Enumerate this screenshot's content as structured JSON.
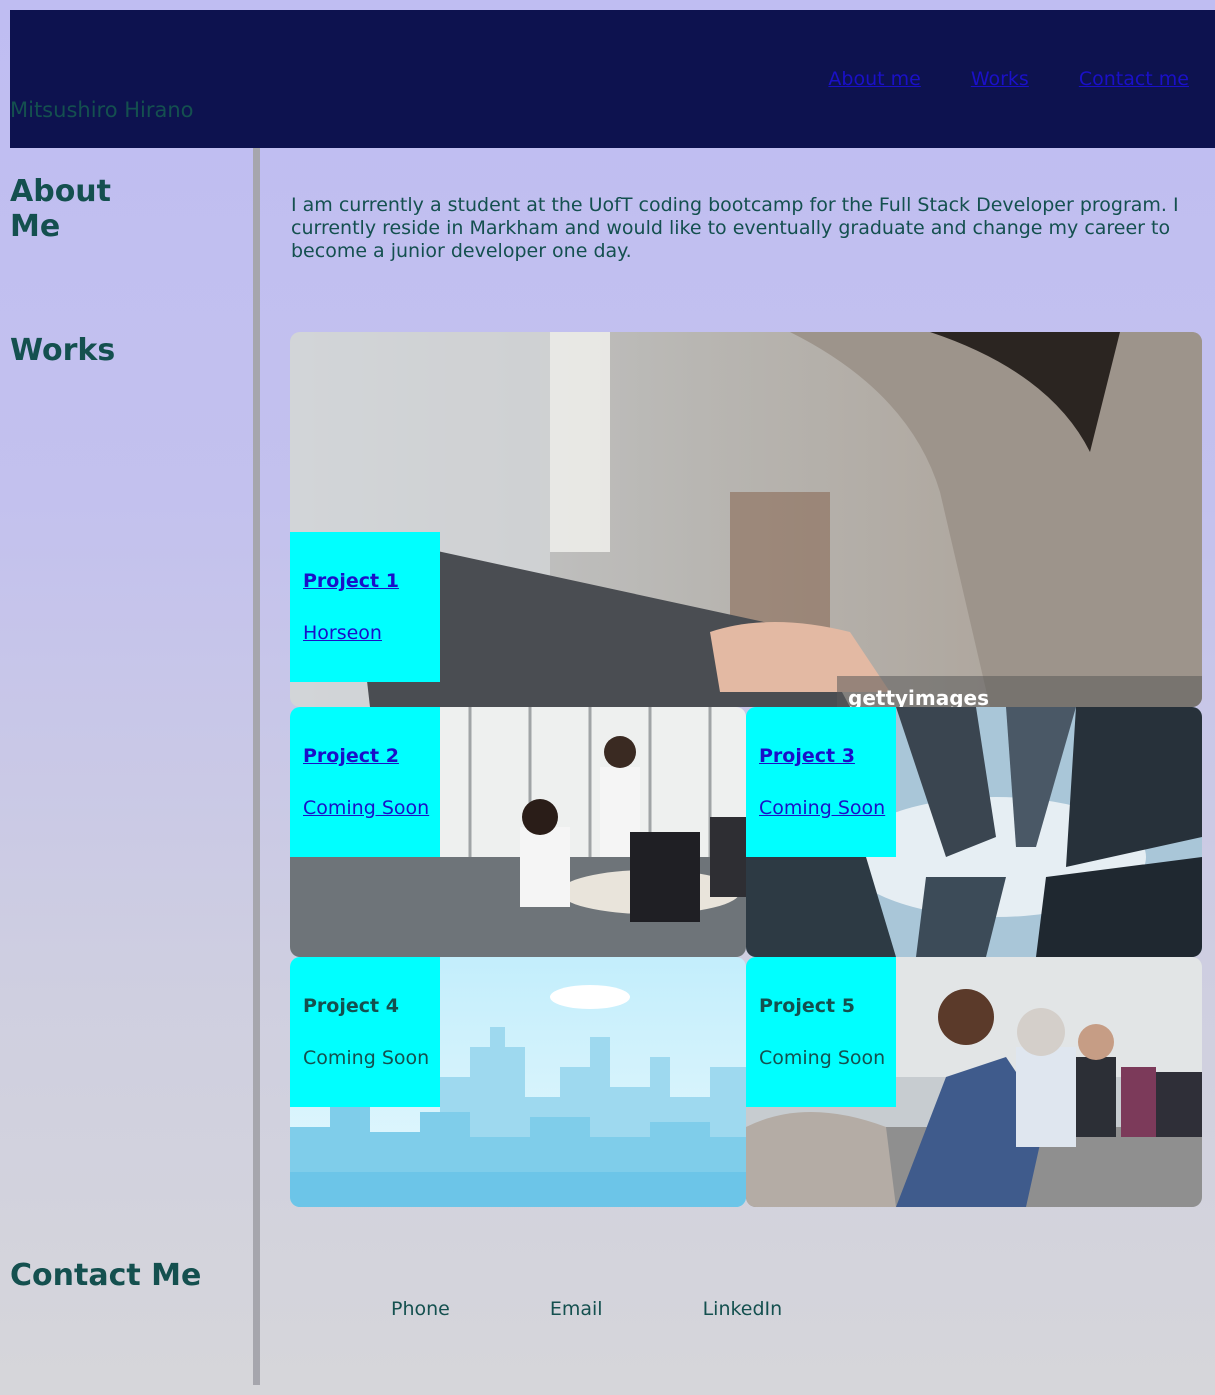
{
  "header": {
    "site_name": "Mitsushiro Hirano",
    "nav": [
      "About me",
      "Works",
      "Contact me"
    ]
  },
  "about": {
    "heading": "About\nMe",
    "text": "I am currently a student at the UofT coding bootcamp for the Full Stack Developer program. I currently reside in Markham and would like to eventually graduate and change my career to become a junior developer one day."
  },
  "works": {
    "heading": "Works",
    "projects": [
      {
        "title": "Project 1",
        "subtitle": "Horseon",
        "watermark": "gettyimages"
      },
      {
        "title": "Project 2",
        "subtitle": "Coming Soon"
      },
      {
        "title": "Project 3",
        "subtitle": "Coming Soon"
      },
      {
        "title": "Project 4",
        "subtitle": "Coming Soon"
      },
      {
        "title": "Project 5",
        "subtitle": "Coming Soon"
      }
    ]
  },
  "contact": {
    "heading": "Contact Me",
    "links": [
      "Phone",
      "Email",
      "LinkedIn"
    ]
  },
  "colors": {
    "header_bg": "#0d124f",
    "text": "#14504f",
    "link": "#1a10c8",
    "overlay": "#00ffff"
  }
}
